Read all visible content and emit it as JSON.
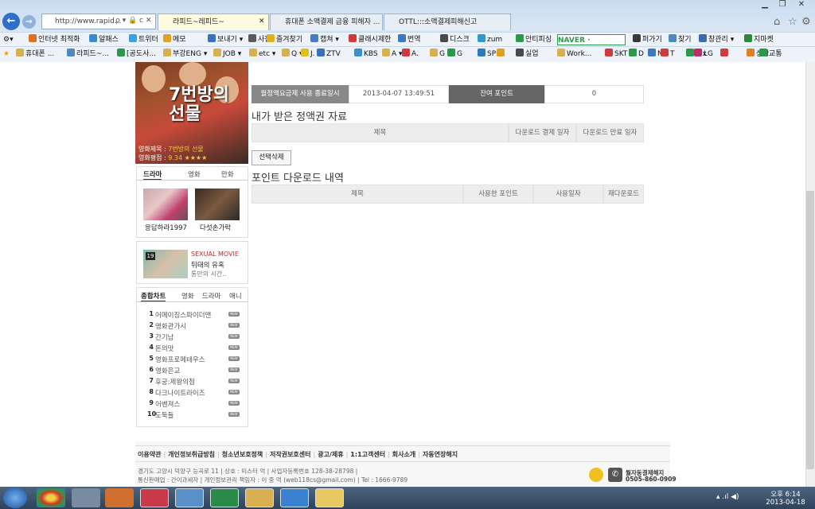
{
  "browser": {
    "address": "http://www.rapid...",
    "addr_icons": "ρ ▾ 🔒 c ✕",
    "tabs": [
      {
        "title": "라피드~레피드~",
        "active": true
      },
      {
        "title": "휴대폰 소액결제 금융 피해자 ...",
        "active": false
      },
      {
        "title": "OTTL:::소액결제피해신고",
        "active": false
      }
    ],
    "toolbar1": [
      "인터넷 최적화",
      "알패스",
      "트위터",
      "메모",
      "보내기 ▾",
      "사전",
      "즐겨찾기",
      "캡쳐 ▾",
      "클래시제한",
      "번역",
      "디스크",
      "zum",
      "안티피싱",
      "NAVER ·",
      "퍼가기",
      "찾기",
      "창관리 ▾",
      "지마켓"
    ],
    "toolbar2": [
      "휴대폰 ...",
      "라피드~...",
      "[공도사...",
      "부강ENG ▾",
      "JOB ▾",
      "etc ▾",
      "Q ▾",
      "J.",
      "ZTV",
      "KBS",
      "A ▾",
      "A.",
      "G ▾",
      "G",
      "SPD",
      "",
      "실업",
      "Work...",
      "SKT",
      "D",
      "N",
      "T",
      "fax",
      "LG",
      "",
      "상황",
      "교통"
    ]
  },
  "sidebar": {
    "poster": {
      "title_line1": "7번방의",
      "title_line2": "선물",
      "movie_label": "영화제목 :",
      "movie_value": "7번방의 선물",
      "score_label": "영화평점 :",
      "score_value": "9.34 ★★★★"
    },
    "media_tabs": [
      "드라마",
      "영화",
      "만화"
    ],
    "thumbs": [
      {
        "caption": "응답하라1997"
      },
      {
        "caption": "다섯손가락"
      }
    ],
    "adult": {
      "badge": "19",
      "tag": "SEXUAL MOVIE",
      "title": "뒤태의 유혹",
      "desc": "통만의 시간.."
    },
    "chart_tabs": [
      "종합차트",
      "영화",
      "드라마",
      "애니"
    ],
    "rank": [
      {
        "num": "1",
        "title": "어메이징스파이더맨",
        "badge": "NEW"
      },
      {
        "num": "2",
        "title": "영화관가시",
        "badge": "NEW"
      },
      {
        "num": "3",
        "title": "간기남",
        "badge": "NEW"
      },
      {
        "num": "4",
        "title": "돈의맛",
        "badge": "NEW"
      },
      {
        "num": "5",
        "title": "영화프로메테우스",
        "badge": "NEW"
      },
      {
        "num": "6",
        "title": "영화은교",
        "badge": "NEW"
      },
      {
        "num": "7",
        "title": "후궁:제왕의첩",
        "badge": "NEW"
      },
      {
        "num": "8",
        "title": "다크나이트라이즈",
        "badge": "NEW"
      },
      {
        "num": "9",
        "title": "어벤져스",
        "badge": "NEW"
      },
      {
        "num": "10",
        "title": "도둑들",
        "badge": "NEW"
      }
    ]
  },
  "main": {
    "info_row": {
      "label": "월정액요금제 사용 종료일시",
      "date": "2013-04-07 13:49:51",
      "points_label": "잔여 포인트",
      "points_value": "0"
    },
    "section1": {
      "title": "내가 받은 정액권 자료",
      "cols": [
        "제목",
        "다운로드 결제 일자",
        "다운로드 만료 일자"
      ]
    },
    "delete_button": "선택삭제",
    "section2": {
      "title": "포인트 다운로드 내역",
      "cols": [
        "제목",
        "사용한 포인트",
        "사용일자",
        "재다운로드"
      ]
    }
  },
  "footer": {
    "links": [
      "이용약관",
      "|",
      "개인정보취급방침",
      "|",
      "청소년보호정책",
      "|",
      "저작권보호센터",
      "|",
      "광고/제휴",
      "|",
      "1:1고객센터",
      "|",
      "회사소개",
      "|",
      "자동연장해지"
    ],
    "line1": "경기도 고양시 덕양구 능곡로 11 | 상호 : 미스터 억 | 사업자등록번호 128-38-28798 |",
    "line2": "통신판매업 : 간이과세자  |  개인정보관리 책임자 : 이 중 억 (web118cs@gmail.com) | Tel : 1666-9789",
    "cs_label": "월자동결제해지",
    "cs_phone": "0505-860-0909"
  },
  "taskbar": {
    "time": "오후 6:14",
    "date": "2013-04-18"
  }
}
